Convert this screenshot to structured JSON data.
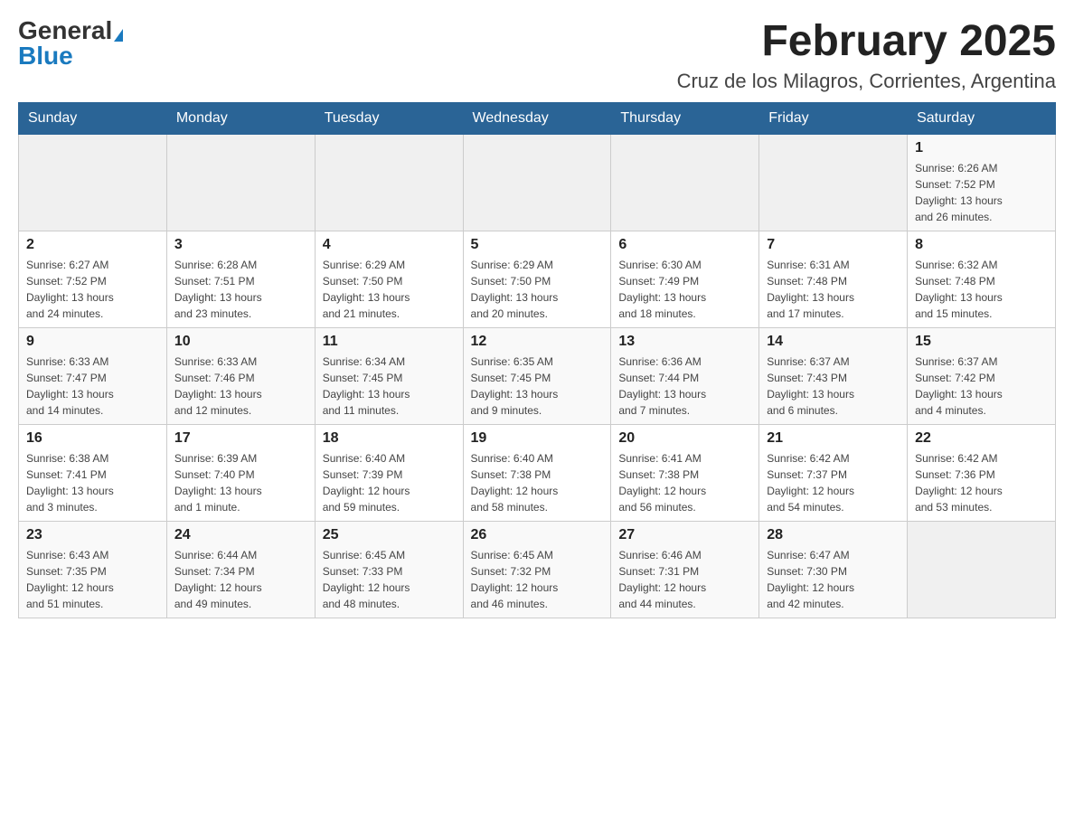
{
  "logo": {
    "general": "General",
    "blue": "Blue"
  },
  "header": {
    "month_year": "February 2025",
    "location": "Cruz de los Milagros, Corrientes, Argentina"
  },
  "days_of_week": [
    "Sunday",
    "Monday",
    "Tuesday",
    "Wednesday",
    "Thursday",
    "Friday",
    "Saturday"
  ],
  "weeks": [
    {
      "days": [
        {
          "number": "",
          "info": ""
        },
        {
          "number": "",
          "info": ""
        },
        {
          "number": "",
          "info": ""
        },
        {
          "number": "",
          "info": ""
        },
        {
          "number": "",
          "info": ""
        },
        {
          "number": "",
          "info": ""
        },
        {
          "number": "1",
          "info": "Sunrise: 6:26 AM\nSunset: 7:52 PM\nDaylight: 13 hours\nand 26 minutes."
        }
      ]
    },
    {
      "days": [
        {
          "number": "2",
          "info": "Sunrise: 6:27 AM\nSunset: 7:52 PM\nDaylight: 13 hours\nand 24 minutes."
        },
        {
          "number": "3",
          "info": "Sunrise: 6:28 AM\nSunset: 7:51 PM\nDaylight: 13 hours\nand 23 minutes."
        },
        {
          "number": "4",
          "info": "Sunrise: 6:29 AM\nSunset: 7:50 PM\nDaylight: 13 hours\nand 21 minutes."
        },
        {
          "number": "5",
          "info": "Sunrise: 6:29 AM\nSunset: 7:50 PM\nDaylight: 13 hours\nand 20 minutes."
        },
        {
          "number": "6",
          "info": "Sunrise: 6:30 AM\nSunset: 7:49 PM\nDaylight: 13 hours\nand 18 minutes."
        },
        {
          "number": "7",
          "info": "Sunrise: 6:31 AM\nSunset: 7:48 PM\nDaylight: 13 hours\nand 17 minutes."
        },
        {
          "number": "8",
          "info": "Sunrise: 6:32 AM\nSunset: 7:48 PM\nDaylight: 13 hours\nand 15 minutes."
        }
      ]
    },
    {
      "days": [
        {
          "number": "9",
          "info": "Sunrise: 6:33 AM\nSunset: 7:47 PM\nDaylight: 13 hours\nand 14 minutes."
        },
        {
          "number": "10",
          "info": "Sunrise: 6:33 AM\nSunset: 7:46 PM\nDaylight: 13 hours\nand 12 minutes."
        },
        {
          "number": "11",
          "info": "Sunrise: 6:34 AM\nSunset: 7:45 PM\nDaylight: 13 hours\nand 11 minutes."
        },
        {
          "number": "12",
          "info": "Sunrise: 6:35 AM\nSunset: 7:45 PM\nDaylight: 13 hours\nand 9 minutes."
        },
        {
          "number": "13",
          "info": "Sunrise: 6:36 AM\nSunset: 7:44 PM\nDaylight: 13 hours\nand 7 minutes."
        },
        {
          "number": "14",
          "info": "Sunrise: 6:37 AM\nSunset: 7:43 PM\nDaylight: 13 hours\nand 6 minutes."
        },
        {
          "number": "15",
          "info": "Sunrise: 6:37 AM\nSunset: 7:42 PM\nDaylight: 13 hours\nand 4 minutes."
        }
      ]
    },
    {
      "days": [
        {
          "number": "16",
          "info": "Sunrise: 6:38 AM\nSunset: 7:41 PM\nDaylight: 13 hours\nand 3 minutes."
        },
        {
          "number": "17",
          "info": "Sunrise: 6:39 AM\nSunset: 7:40 PM\nDaylight: 13 hours\nand 1 minute."
        },
        {
          "number": "18",
          "info": "Sunrise: 6:40 AM\nSunset: 7:39 PM\nDaylight: 12 hours\nand 59 minutes."
        },
        {
          "number": "19",
          "info": "Sunrise: 6:40 AM\nSunset: 7:38 PM\nDaylight: 12 hours\nand 58 minutes."
        },
        {
          "number": "20",
          "info": "Sunrise: 6:41 AM\nSunset: 7:38 PM\nDaylight: 12 hours\nand 56 minutes."
        },
        {
          "number": "21",
          "info": "Sunrise: 6:42 AM\nSunset: 7:37 PM\nDaylight: 12 hours\nand 54 minutes."
        },
        {
          "number": "22",
          "info": "Sunrise: 6:42 AM\nSunset: 7:36 PM\nDaylight: 12 hours\nand 53 minutes."
        }
      ]
    },
    {
      "days": [
        {
          "number": "23",
          "info": "Sunrise: 6:43 AM\nSunset: 7:35 PM\nDaylight: 12 hours\nand 51 minutes."
        },
        {
          "number": "24",
          "info": "Sunrise: 6:44 AM\nSunset: 7:34 PM\nDaylight: 12 hours\nand 49 minutes."
        },
        {
          "number": "25",
          "info": "Sunrise: 6:45 AM\nSunset: 7:33 PM\nDaylight: 12 hours\nand 48 minutes."
        },
        {
          "number": "26",
          "info": "Sunrise: 6:45 AM\nSunset: 7:32 PM\nDaylight: 12 hours\nand 46 minutes."
        },
        {
          "number": "27",
          "info": "Sunrise: 6:46 AM\nSunset: 7:31 PM\nDaylight: 12 hours\nand 44 minutes."
        },
        {
          "number": "28",
          "info": "Sunrise: 6:47 AM\nSunset: 7:30 PM\nDaylight: 12 hours\nand 42 minutes."
        },
        {
          "number": "",
          "info": ""
        }
      ]
    }
  ]
}
